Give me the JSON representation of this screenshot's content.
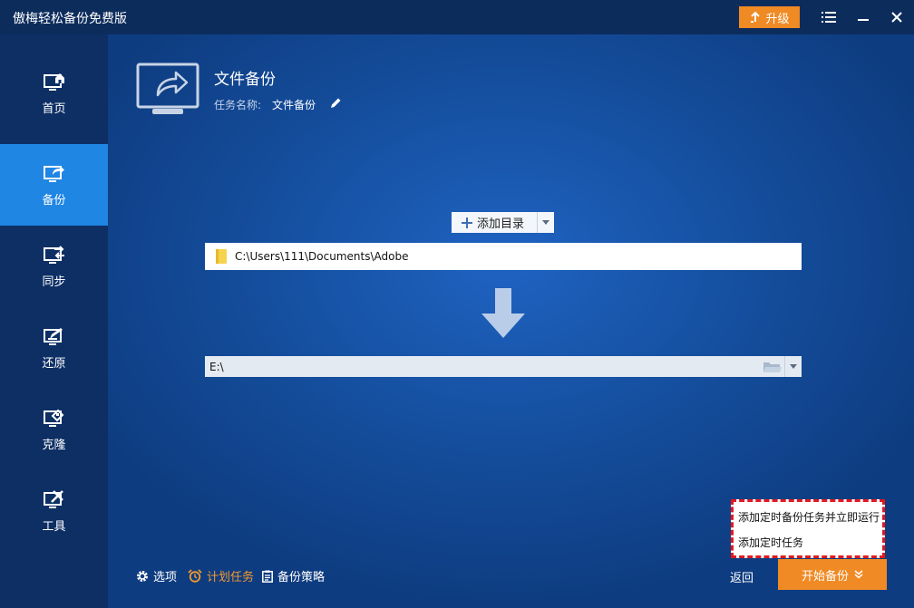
{
  "app": {
    "title": "傲梅轻松备份免费版"
  },
  "titlebar": {
    "upgrade_label": "升级",
    "menu_icon": "menu-icon",
    "minimize_icon": "minimize-icon",
    "close_icon": "close-icon"
  },
  "sidebar": {
    "items": [
      {
        "label": "首页",
        "icon": "home-monitor-icon",
        "active": false
      },
      {
        "label": "备份",
        "icon": "backup-monitor-icon",
        "active": true
      },
      {
        "label": "同步",
        "icon": "sync-monitor-icon",
        "active": false
      },
      {
        "label": "还原",
        "icon": "restore-monitor-icon",
        "active": false
      },
      {
        "label": "克隆",
        "icon": "clone-monitor-icon",
        "active": false
      },
      {
        "label": "工具",
        "icon": "tools-monitor-icon",
        "active": false
      }
    ]
  },
  "header": {
    "title": "文件备份",
    "task_label": "任务名称:",
    "task_name": "文件备份"
  },
  "source": {
    "add_dir_label": "添加目录",
    "path": "C:\\Users\\111\\Documents\\Adobe"
  },
  "destination": {
    "path": "E:\\"
  },
  "footer": {
    "options_label": "选项",
    "schedule_label": "计划任务",
    "strategy_label": "备份策略",
    "back_label": "返回",
    "start_label": "开始备份"
  },
  "popup": {
    "options": [
      "添加定时备份任务并立即运行",
      "添加定时任务"
    ]
  },
  "colors": {
    "accent": "#f08a24",
    "active_nav": "#1f86e3",
    "sidebar": "#0d2f64",
    "popup_border": "#e0191f"
  }
}
